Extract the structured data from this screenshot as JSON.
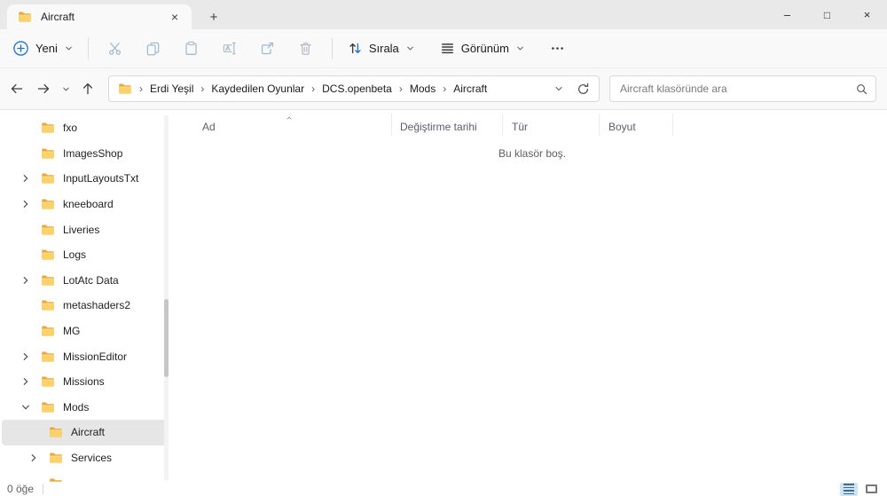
{
  "colors": {
    "accent_blue": "#2472c8",
    "disabled_icon_blue": "#a0bad2",
    "folder_front": "#fbd169",
    "folder_back": "#e9a83d",
    "selection_gray": "#e6e6e6",
    "titlebar_gray": "#e9e9e9",
    "chrome_bg": "#f9f9f9"
  },
  "titlebar": {
    "tab_title": "Aircraft",
    "tab_close_glyph": "×",
    "new_tab_glyph": "+",
    "controls": {
      "minimize": "–",
      "maximize": "□",
      "close": "×"
    }
  },
  "toolbar": {
    "new_label": "Yeni",
    "sort_label": "Sırala",
    "view_label": "Görünüm",
    "icons": [
      "new-circle-plus",
      "cut",
      "copy",
      "paste",
      "rename",
      "share",
      "delete",
      "sort-arrows",
      "view-list",
      "more-ellipsis"
    ]
  },
  "addressbar": {
    "breadcrumbs": [
      "Erdi Yeşil",
      "Kaydedilen Oyunlar",
      "DCS.openbeta",
      "Mods",
      "Aircraft"
    ],
    "search_placeholder": "Aircraft klasöründe ara"
  },
  "sidebar": {
    "items": [
      {
        "label": "fxo",
        "chevron": "none",
        "level": 0
      },
      {
        "label": "ImagesShop",
        "chevron": "none",
        "level": 0
      },
      {
        "label": "InputLayoutsTxt",
        "chevron": "right",
        "level": 0
      },
      {
        "label": "kneeboard",
        "chevron": "right",
        "level": 0
      },
      {
        "label": "Liveries",
        "chevron": "none",
        "level": 0
      },
      {
        "label": "Logs",
        "chevron": "none",
        "level": 0
      },
      {
        "label": "LotAtc Data",
        "chevron": "right",
        "level": 0
      },
      {
        "label": "metashaders2",
        "chevron": "none",
        "level": 0
      },
      {
        "label": "MG",
        "chevron": "none",
        "level": 0
      },
      {
        "label": "MissionEditor",
        "chevron": "right",
        "level": 0
      },
      {
        "label": "Missions",
        "chevron": "right",
        "level": 0
      },
      {
        "label": "Mods",
        "chevron": "down",
        "level": 0
      },
      {
        "label": "Aircraft",
        "chevron": "none",
        "level": 1,
        "selected": true
      },
      {
        "label": "Services",
        "chevron": "right",
        "level": 1
      },
      {
        "label": "",
        "chevron": "none",
        "level": 1,
        "partial": true
      }
    ]
  },
  "main": {
    "columns": [
      {
        "label": "Ad",
        "sorted": true
      },
      {
        "label": "Değiştirme tarihi"
      },
      {
        "label": "Tür"
      },
      {
        "label": "Boyut"
      }
    ],
    "empty_message": "Bu klasör boş."
  },
  "statusbar": {
    "item_count": "0 öğe"
  }
}
